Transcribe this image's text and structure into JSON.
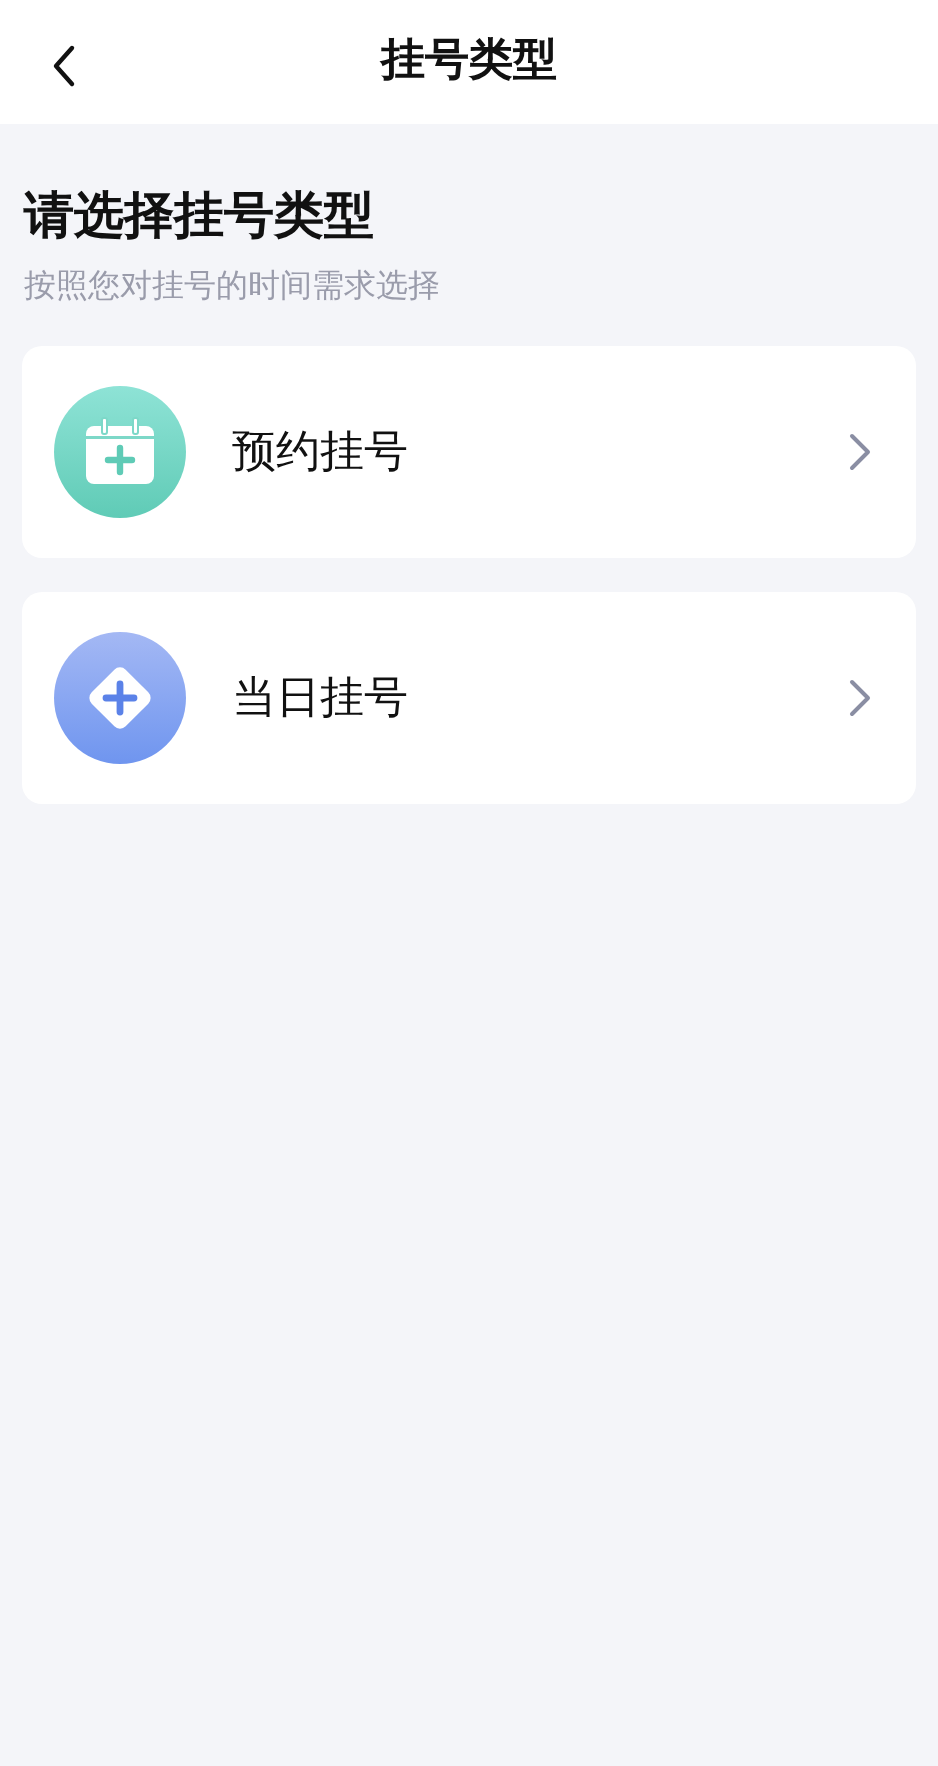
{
  "header": {
    "title": "挂号类型"
  },
  "heading": "请选择挂号类型",
  "subtitle": "按照您对挂号的时间需求选择",
  "options": [
    {
      "kind": "calendar",
      "label": "预约挂号"
    },
    {
      "kind": "diamond",
      "label": "当日挂号"
    }
  ]
}
